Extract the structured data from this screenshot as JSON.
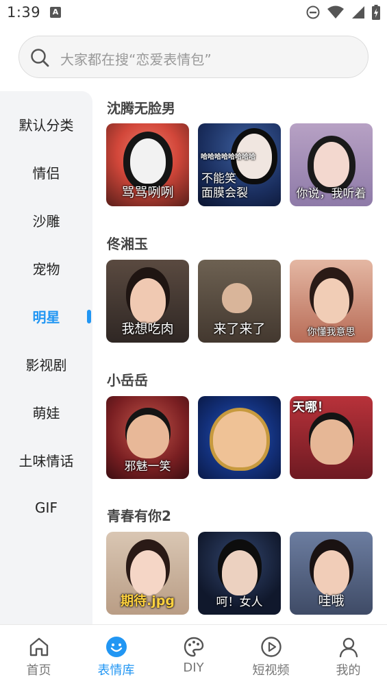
{
  "status_bar": {
    "time": "1:39",
    "notification_letter": "A"
  },
  "search": {
    "placeholder": "大家都在搜“恋爱表情包”"
  },
  "sidebar": {
    "items": [
      {
        "label": "默认分类",
        "active": false
      },
      {
        "label": "情侣",
        "active": false
      },
      {
        "label": "沙雕",
        "active": false
      },
      {
        "label": "宠物",
        "active": false
      },
      {
        "label": "明星",
        "active": true
      },
      {
        "label": "影视剧",
        "active": false
      },
      {
        "label": "萌娃",
        "active": false
      },
      {
        "label": "土味情话",
        "active": false
      },
      {
        "label": "GIF",
        "active": false
      }
    ]
  },
  "sections": [
    {
      "title": "沈腾无脸男",
      "stickers": [
        {
          "caption": "骂骂咧咧"
        },
        {
          "caption": "不能笑\n面膜会裂",
          "top_caption": "哈哈哈哈哈哈哈哈"
        },
        {
          "caption": "你说，我听着"
        }
      ]
    },
    {
      "title": "佟湘玉",
      "stickers": [
        {
          "caption": "我想吃肉"
        },
        {
          "caption": "来了来了"
        },
        {
          "caption": "你懂我意思"
        }
      ]
    },
    {
      "title": "小岳岳",
      "stickers": [
        {
          "caption": "邪魅一笑"
        },
        {
          "caption": ""
        },
        {
          "caption": "天哪！"
        }
      ]
    },
    {
      "title": "青春有你2",
      "stickers": [
        {
          "caption": "期待.jpg"
        },
        {
          "caption": "呵！女人"
        },
        {
          "caption": "哇哦"
        }
      ]
    }
  ],
  "tabbar": {
    "tabs": [
      {
        "label": "首页",
        "icon": "home-icon",
        "active": false
      },
      {
        "label": "表情库",
        "icon": "smiley-icon",
        "active": true
      },
      {
        "label": "DIY",
        "icon": "palette-icon",
        "active": false
      },
      {
        "label": "短视频",
        "icon": "play-circle-icon",
        "active": false
      },
      {
        "label": "我的",
        "icon": "person-icon",
        "active": false
      }
    ]
  },
  "colors": {
    "accent": "#2196f3",
    "sidebar_bg": "#f3f4f6"
  }
}
